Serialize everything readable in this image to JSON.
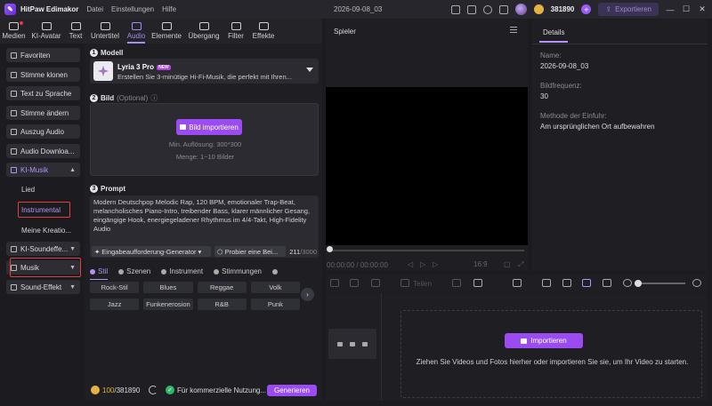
{
  "titlebar": {
    "app_name": "HitPaw Edimakor",
    "menus": [
      "Datei",
      "Einstellungen",
      "Hilfe"
    ],
    "project_name": "2026-09-08_03",
    "credits": "381890",
    "export_label": "Exportieren"
  },
  "toolbar": {
    "tabs": [
      {
        "label": "Medien",
        "icon": "media-icon"
      },
      {
        "label": "KI-Avatar",
        "icon": "avatar-icon"
      },
      {
        "label": "Text",
        "icon": "text-icon"
      },
      {
        "label": "Untertitel",
        "icon": "subtitle-icon"
      },
      {
        "label": "Audio",
        "icon": "audio-icon",
        "active": true
      },
      {
        "label": "Elemente",
        "icon": "elements-icon"
      },
      {
        "label": "Übergang",
        "icon": "transition-icon"
      },
      {
        "label": "Filter",
        "icon": "filter-icon"
      },
      {
        "label": "Effekte",
        "icon": "effects-icon"
      }
    ]
  },
  "sidebar": {
    "items": [
      {
        "label": "Favoriten"
      },
      {
        "label": "Stimme klonen"
      },
      {
        "label": "Text zu Sprache"
      },
      {
        "label": "Stimme ändern"
      },
      {
        "label": "Auszug Audio"
      },
      {
        "label": "Audio Downloa..."
      },
      {
        "label": "KI-Musik"
      },
      {
        "label": "KI-Soundeffe..."
      },
      {
        "label": "Musik"
      },
      {
        "label": "Sound-Effekt"
      }
    ],
    "submenu": [
      "Lied",
      "Instrumental",
      "Meine Kreatio..."
    ]
  },
  "panel": {
    "model": {
      "heading": "Modell",
      "name": "Lyria 3 Pro",
      "badge": "NEW",
      "description": "Erstellen Sie 3-minütige Hi-Fi-Musik, die perfekt mit Ihren..."
    },
    "image": {
      "heading": "Bild",
      "optional": "(Optional)",
      "import_label": "Bild importieren",
      "resolution_hint": "Min. Auflösung: 300*300",
      "count_hint": "Menge: 1~10 Bilder"
    },
    "prompt": {
      "heading": "Prompt",
      "text": "Modern Deutschpop Melodic Rap, 120 BPM, emotionaler Trap-Beat, melancholisches Piano-Intro, treibender Bass, klarer männlicher Gesang, eingängige Hook, energiegeladener Rhythmus im 4/4-Takt, High-Fidelity Audio",
      "generator_label": "Eingabeaufforderung-Generator",
      "try_label": "Probier eine Bei...",
      "count": "211",
      "max": "/3000"
    },
    "style_tabs": [
      "Stil",
      "Szenen",
      "Instrument",
      "Stimmungen"
    ],
    "style_tags": [
      "Rock-Stil",
      "Blues",
      "Reggae",
      "Volk",
      "Jazz",
      "Funkenerosion",
      "R&B",
      "Punk"
    ],
    "footer": {
      "credits_used": "100",
      "credits_total": "/381890",
      "commercial_label": "Für kommerzielle Nutzung...",
      "generate_label": "Generieren"
    }
  },
  "player": {
    "title": "Spieler",
    "time": "00:00:00 / 00:00:00",
    "ratio": "16:9"
  },
  "details": {
    "tab": "Details",
    "name_label": "Name:",
    "name_value": "2026-09-08_03",
    "framerate_label": "Bildfrequenz:",
    "framerate_value": "30",
    "method_label": "Methode der Einfuhr:",
    "method_value": "Am ursprünglichen Ort aufbewahren"
  },
  "timeline": {
    "split_label": "Teilen",
    "import_label": "Importieren",
    "drop_text": "Ziehen Sie Videos und Fotos hierher oder importieren Sie sie, um Ihr Video zu starten."
  }
}
